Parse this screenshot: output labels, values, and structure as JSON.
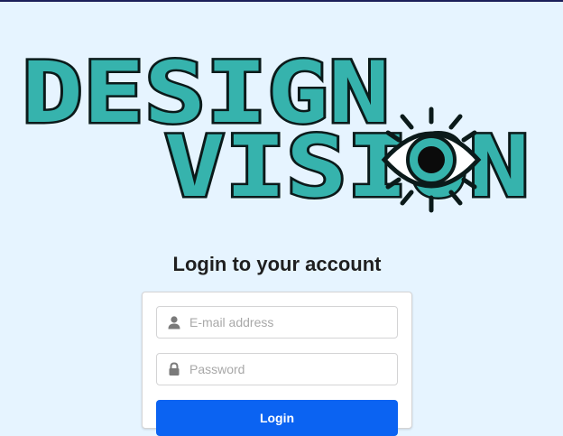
{
  "logo": {
    "line1": "DESIGN",
    "line2": "VISION",
    "colors": {
      "fill": "#36b3ad",
      "outline": "#0b1a1a",
      "background": "#e6f4ff"
    }
  },
  "login": {
    "title": "Login to your account",
    "email_placeholder": "E-mail address",
    "password_placeholder": "Password",
    "submit_label": "Login",
    "accent": "#0b63f2"
  },
  "icons": {
    "email": "user-icon",
    "password": "lock-icon",
    "logo_eye": "eye-icon"
  }
}
